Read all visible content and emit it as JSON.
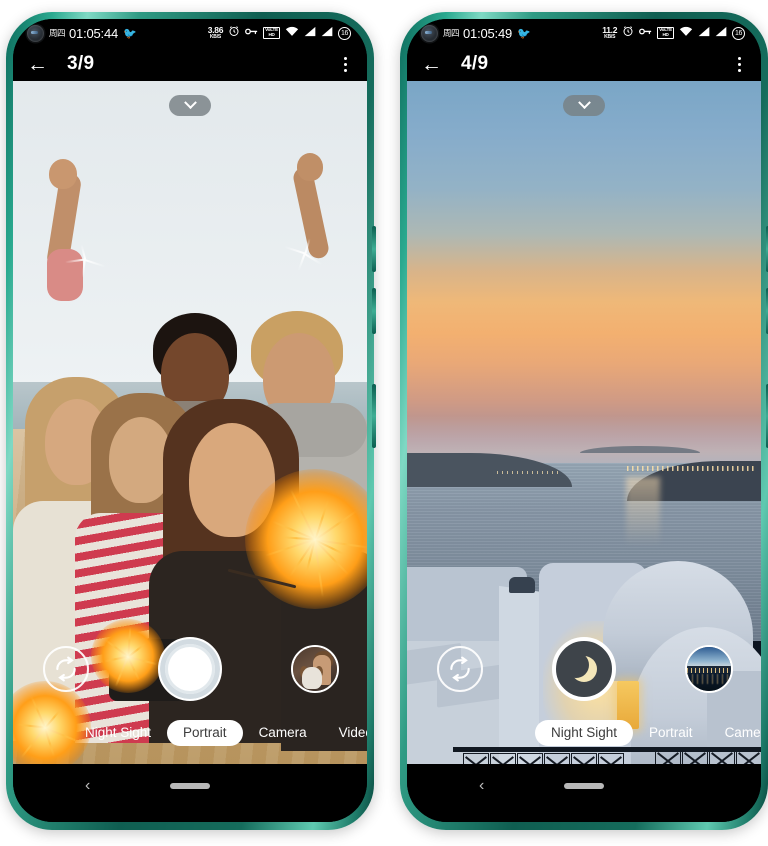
{
  "phones": [
    {
      "id": "phone-left",
      "status_bar": {
        "weekday": "周四",
        "clock": "01:05:44",
        "bird_icon": "bird-icon",
        "net_speed_value": "3.86",
        "net_speed_unit": "KB/S",
        "alarm_icon": "alarm-clock-icon",
        "key_icon": "vpn-key-icon",
        "volte_line1": "VoLTE",
        "volte_line2": "HD",
        "wifi_icon": "wifi-icon",
        "signal1_icon": "signal-bars-icon",
        "signal2_icon": "signal-bars-icon",
        "battery_level": "16"
      },
      "header": {
        "back_label": "←",
        "title": "3/9",
        "overflow_label": "more-options"
      },
      "viewfinder": {
        "collapse_label": "collapse-controls",
        "scene": "beach-group-selfie-with-sparklers"
      },
      "controls": {
        "flip_label": "switch-camera",
        "shutter_label": "shutter",
        "shutter_style": "portrait",
        "gallery_label": "gallery-thumbnail",
        "gallery_thumb": "girl-with-dog-photo"
      },
      "modes": {
        "items": [
          "Night Sight",
          "Portrait",
          "Camera",
          "Video"
        ],
        "active": "Portrait"
      },
      "navbar": {
        "back_label": "‹",
        "home_label": "home-indicator"
      }
    },
    {
      "id": "phone-right",
      "status_bar": {
        "weekday": "周四",
        "clock": "01:05:49",
        "bird_icon": "bird-icon",
        "net_speed_value": "11.2",
        "net_speed_unit": "KB/S",
        "alarm_icon": "alarm-clock-icon",
        "key_icon": "vpn-key-icon",
        "volte_line1": "VoLTE",
        "volte_line2": "HD",
        "wifi_icon": "wifi-icon",
        "signal1_icon": "signal-bars-icon",
        "signal2_icon": "signal-bars-icon",
        "battery_level": "16"
      },
      "header": {
        "back_label": "←",
        "title": "4/9",
        "overflow_label": "more-options"
      },
      "viewfinder": {
        "collapse_label": "collapse-controls",
        "scene": "santorini-sunset-seascape"
      },
      "controls": {
        "flip_label": "switch-camera",
        "shutter_label": "shutter",
        "shutter_style": "night",
        "gallery_label": "gallery-thumbnail",
        "gallery_thumb": "night-cityscape-photo"
      },
      "modes": {
        "items": [
          "Night Sight",
          "Portrait",
          "Camera"
        ],
        "active": "Night Sight"
      },
      "navbar": {
        "back_label": "‹",
        "home_label": "home-indicator"
      }
    }
  ],
  "colors": {
    "frame": "#1d7a68",
    "frame_highlight": "#7fd9c4",
    "screen_bg": "#000000",
    "accent_white": "#ffffff",
    "mode_active_text": "#3c3c3c",
    "page_bg": "#ffffff"
  }
}
